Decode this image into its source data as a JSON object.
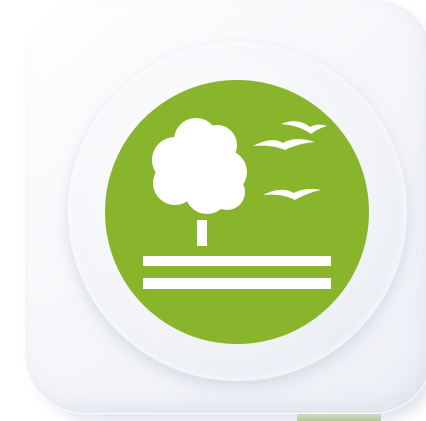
{
  "icon": {
    "name": "park-landscape-icon",
    "description_colors": {
      "badge_green": "#88b52c",
      "accent_strip_green": "#7fae2a",
      "tile_background": "#f4f5f8",
      "glyph_white": "#ffffff"
    },
    "elements": [
      "tree-icon",
      "bird-icon",
      "bird-icon",
      "ground-lines-icon"
    ]
  }
}
